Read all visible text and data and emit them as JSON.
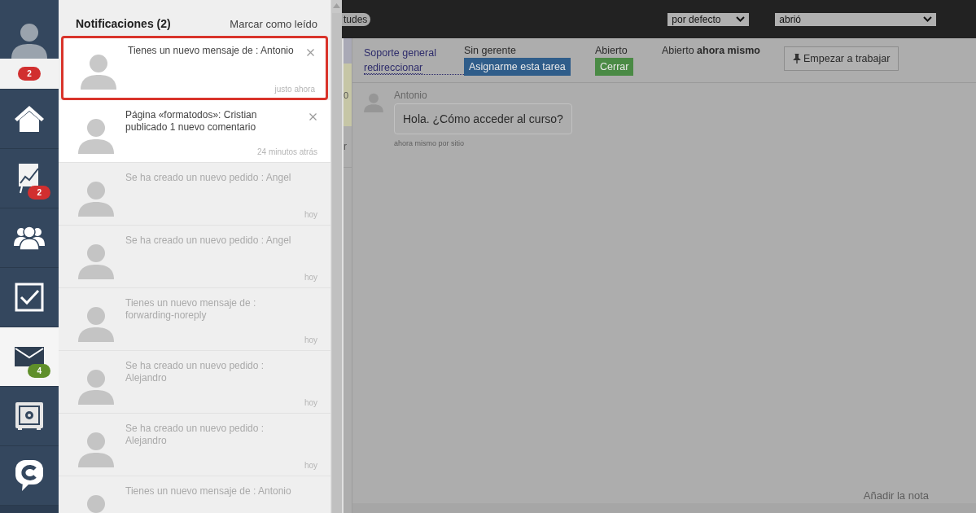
{
  "nav": [
    {
      "kind": "profile",
      "badge": "2",
      "color": "#d12f2f",
      "selected": false
    },
    {
      "kind": "home",
      "selected": false
    },
    {
      "kind": "chart",
      "badge": "2",
      "color": "#d12f2f",
      "selected": false
    },
    {
      "kind": "people",
      "selected": false
    },
    {
      "kind": "tasks",
      "selected": false
    },
    {
      "kind": "mail",
      "badge": "4",
      "color": "#5f8f2a",
      "selected": true
    },
    {
      "kind": "safe",
      "selected": false
    },
    {
      "kind": "chat",
      "selected": false
    }
  ],
  "notifications": {
    "title": "Notificaciones (2)",
    "mark_read": "Marcar como leído",
    "items": [
      {
        "text": "Tienes un nuevo mensaje de : Antonio",
        "time": "justo ahora",
        "unread": true,
        "highlighted": true
      },
      {
        "text": "Página «formatodos»: Cristian publicado 1 nuevo comentario",
        "time": "24 minutos atrás",
        "unread": true,
        "highlighted": false
      },
      {
        "text": "Se ha creado un nuevo pedido : Angel",
        "time": "hoy",
        "unread": false,
        "highlighted": false
      },
      {
        "text": "Se ha creado un nuevo pedido : Angel",
        "time": "hoy",
        "unread": false,
        "highlighted": false
      },
      {
        "text": "Tienes un nuevo mensaje de : forwarding-noreply",
        "time": "hoy",
        "unread": false,
        "highlighted": false
      },
      {
        "text": "Se ha creado un nuevo pedido : Alejandro",
        "time": "hoy",
        "unread": false,
        "highlighted": false
      },
      {
        "text": "Se ha creado un nuevo pedido : Alejandro",
        "time": "hoy",
        "unread": false,
        "highlighted": false
      },
      {
        "text": "Tienes un nuevo mensaje de : Antonio",
        "unread": false,
        "highlighted": false
      }
    ]
  },
  "top_bar": {
    "tag": "tudes",
    "sort_select": "por defecto",
    "status_select": "abrió"
  },
  "left_column_fragments": [
    "0",
    "r"
  ],
  "task": {
    "fields": [
      {
        "kind": "link",
        "label": "Soporte general",
        "value": "redireccionar"
      },
      {
        "kind": "button",
        "label": "Sin gerente",
        "value": "Asignarme esta tarea",
        "color": "#2f5d8a"
      },
      {
        "kind": "button",
        "label": "Abierto",
        "value": "Cerrar",
        "color": "#4a8a45"
      },
      {
        "kind": "rich",
        "label": "Abierto **ahora mismo**"
      }
    ],
    "action_button": "Empezar a trabajar"
  },
  "messages": [
    {
      "author": "Antonio",
      "text": "Hola. ¿Cómo acceder al curso?",
      "meta": "ahora mismo por sitio"
    }
  ],
  "add_note": "Añadir la nota"
}
